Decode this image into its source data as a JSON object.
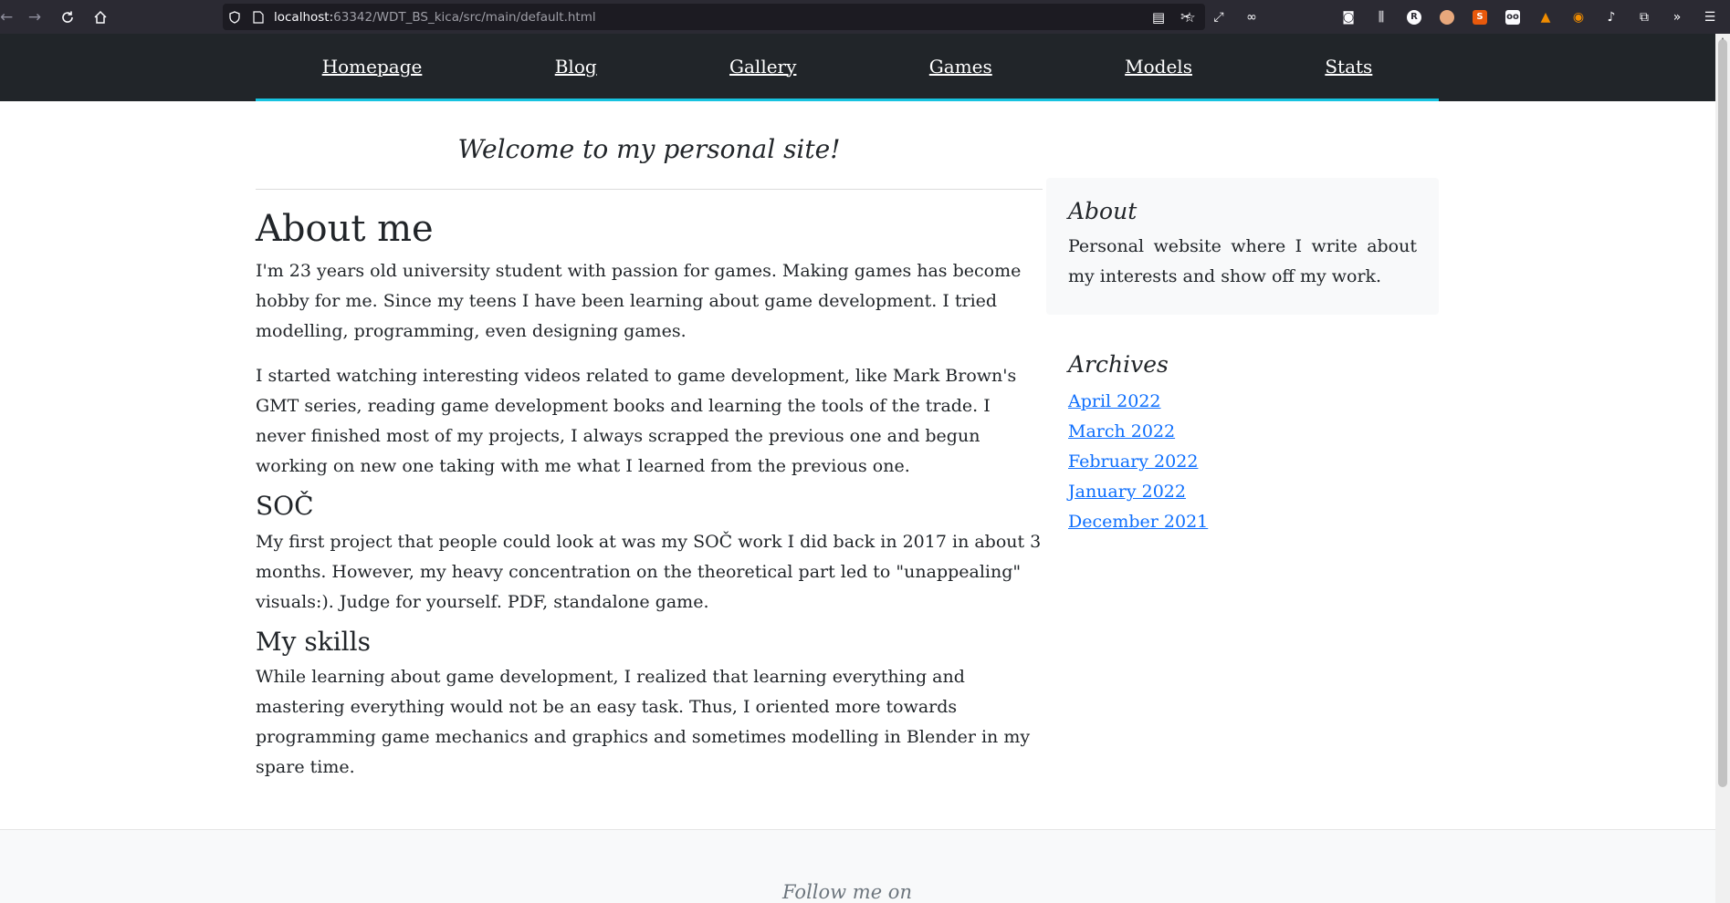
{
  "browser": {
    "url_host": "localhost:",
    "url_rest": "63342/WDT_BS_kica/src/main/default.html"
  },
  "nav": {
    "items": [
      {
        "label": "Homepage"
      },
      {
        "label": "Blog"
      },
      {
        "label": "Gallery"
      },
      {
        "label": "Games"
      },
      {
        "label": "Models"
      },
      {
        "label": "Stats"
      }
    ]
  },
  "welcome": "Welcome to my personal site!",
  "main": {
    "heading": "About me",
    "intro_p1": "I'm 23 years old university student with passion for games. Making games has become hobby for me. Since my teens I have been learning about game development. I tried modelling, programming, even designing games.",
    "intro_p2": "I started watching interesting videos related to game development, like Mark Brown's GMT series, reading game development books and learning the tools of the trade. I never finished most of my projects, I always scrapped the previous one and begun working on new one taking with me what I learned from the previous one.",
    "soc_heading": "SOČ",
    "soc_p": "My first project that people could look at was my SOČ work I did back in 2017 in about 3 months. However, my heavy concentration on the theoretical part led to \"unappealing\" visuals:). Judge for yourself. PDF, standalone game.",
    "skills_heading": "My skills",
    "skills_p": "While learning about game development, I realized that learning everything and mastering everything would not be an easy task. Thus, I oriented more towards programming game mechanics and graphics and sometimes modelling in Blender in my spare time."
  },
  "sidebar": {
    "about_title": "About",
    "about_text": "Personal website where I write about my interests and show off my work.",
    "archives_title": "Archives",
    "archives": [
      {
        "label": "April 2022"
      },
      {
        "label": "March 2022"
      },
      {
        "label": "February 2022"
      },
      {
        "label": "January 2022"
      },
      {
        "label": "December 2021"
      }
    ]
  },
  "footer": {
    "text": "Follow me on"
  },
  "colors": {
    "nav_bg": "#212529",
    "nav_accent": "#17c3e0",
    "link": "#0d6efd",
    "sidebar_bg": "#f8f9fa"
  }
}
